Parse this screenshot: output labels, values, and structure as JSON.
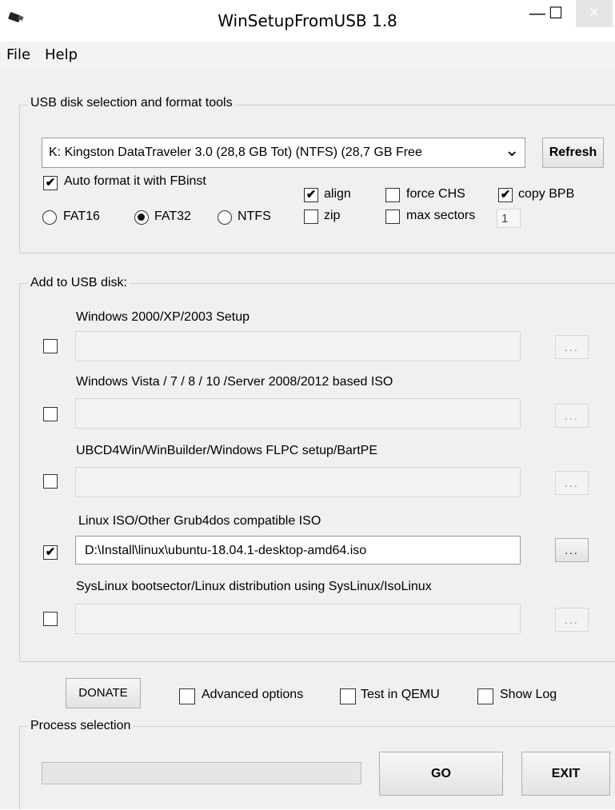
{
  "window": {
    "title": "WinSetupFromUSB 1.8",
    "app_icon": "usb-drive-icon",
    "minimize_glyph": "—",
    "maximize_glyph": "☐",
    "close_glyph": "✕"
  },
  "menu": {
    "items": [
      "File",
      "Help"
    ]
  },
  "usb_section": {
    "label": "USB disk selection and format tools",
    "disk_value": "K: Kingston DataTraveler 3.0 (28,8 GB Tot) (NTFS) (28,7 GB Free",
    "dropdown_glyph": "⌄",
    "refresh_label": "Refresh",
    "auto_format_label": "Auto format it with FBinst",
    "auto_format_checked": true,
    "fat16_label": "FAT16",
    "fat32_label": "FAT32",
    "ntfs_label": "NTFS",
    "selected_fs": "FAT32",
    "align_label": "align",
    "align_checked": true,
    "zip_label": "zip",
    "zip_checked": false,
    "force_chs_label": "force CHS",
    "force_chs_checked": false,
    "max_sectors_label": "max sectors",
    "max_sectors_checked": false,
    "max_sectors_value": "1",
    "copy_bpb_label": "copy BPB",
    "copy_bpb_checked": true
  },
  "add_section": {
    "label": "Add to USB disk:",
    "browse_label": "...",
    "items": [
      {
        "label": "Windows 2000/XP/2003 Setup",
        "checked": false,
        "path": ""
      },
      {
        "label": "Windows Vista / 7 / 8 / 10 /Server 2008/2012 based ISO",
        "checked": false,
        "path": ""
      },
      {
        "label": "UBCD4Win/WinBuilder/Windows FLPC setup/BartPE",
        "checked": false,
        "path": ""
      },
      {
        "label": "Linux ISO/Other Grub4dos compatible ISO",
        "checked": true,
        "path": "D:\\Install\\linux\\ubuntu-18.04.1-desktop-amd64.iso"
      },
      {
        "label": "SysLinux bootsector/Linux distribution using SysLinux/IsoLinux",
        "checked": false,
        "path": ""
      }
    ]
  },
  "bottom": {
    "donate_label": "DONATE",
    "advanced_label": "Advanced options",
    "advanced_checked": false,
    "qemu_label": "Test in QEMU",
    "qemu_checked": false,
    "showlog_label": "Show Log",
    "showlog_checked": false
  },
  "process": {
    "label": "Process selection",
    "progress": 0,
    "go_label": "GO",
    "exit_label": "EXIT"
  },
  "check_glyph": "✔"
}
